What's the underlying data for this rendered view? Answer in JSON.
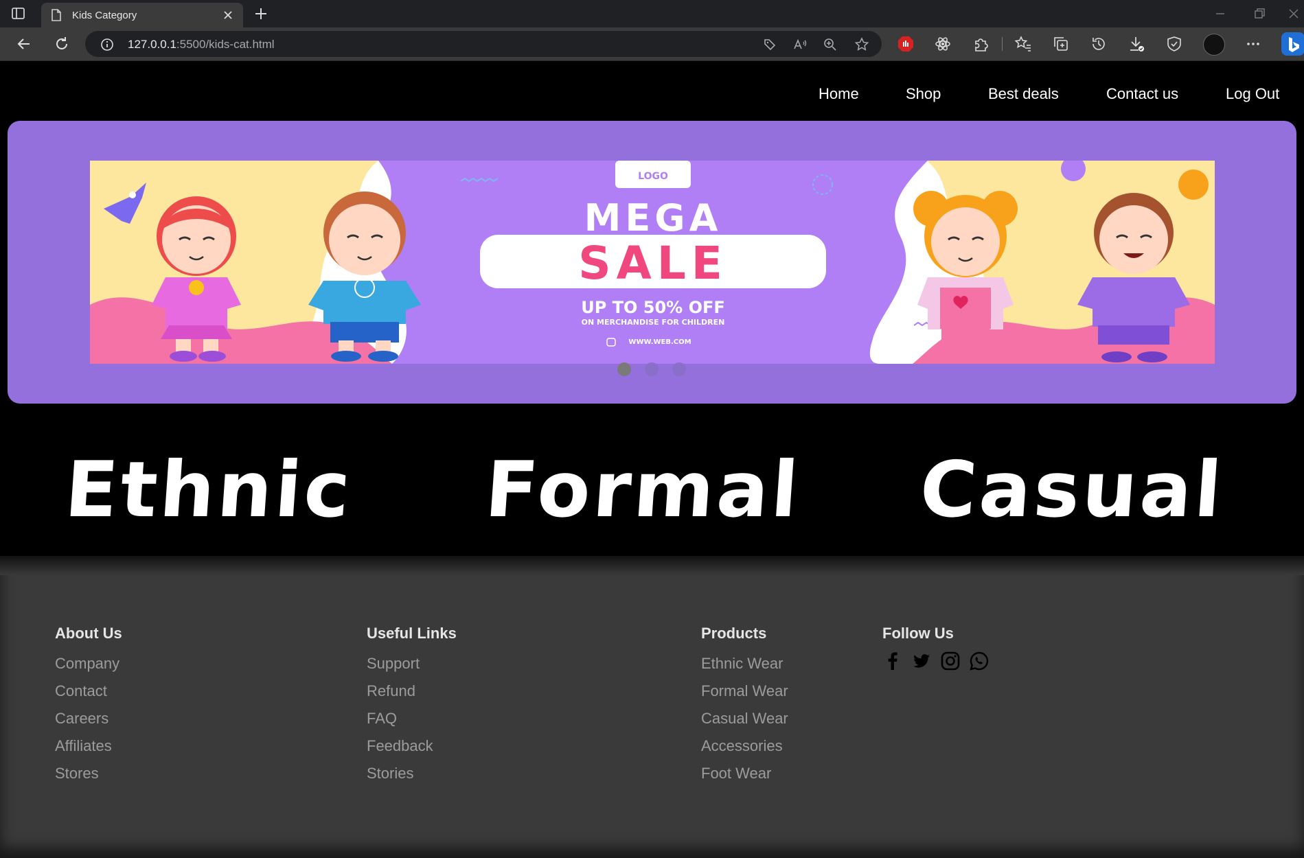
{
  "browser": {
    "tab_title": "Kids Category",
    "url_host": "127.0.0.1",
    "url_rest": ":5500/kids-cat.html"
  },
  "nav": {
    "links": [
      "Home",
      "Shop",
      "Best deals",
      "Contact us",
      "Log Out"
    ]
  },
  "banner": {
    "logo_text": "LOGO",
    "headline_1": "MEGA",
    "headline_2": "SALE",
    "offer": "UP TO 50% OFF",
    "offer_sub": "ON MERCHANDISE FOR CHILDREN",
    "website": "WWW.WEB.COM",
    "slide_count": 3,
    "active_slide": 1
  },
  "categories": [
    "Ethnic",
    "Formal",
    "Casual"
  ],
  "footer": {
    "about": {
      "title": "About Us",
      "links": [
        "Company",
        "Contact",
        "Careers",
        "Affiliates",
        "Stores"
      ]
    },
    "useful": {
      "title": "Useful Links",
      "links": [
        "Support",
        "Refund",
        "FAQ",
        "Feedback",
        "Stories"
      ]
    },
    "products": {
      "title": "Products",
      "links": [
        "Ethnic Wear",
        "Formal Wear",
        "Casual Wear",
        "Accessories",
        "Foot Wear"
      ]
    },
    "follow": {
      "title": "Follow Us",
      "icons": [
        "facebook-icon",
        "twitter-icon",
        "instagram-icon",
        "whatsapp-icon"
      ]
    }
  },
  "colors": {
    "hero_bg": "#9370db",
    "banner_purple": "#b07ef5",
    "sale_pink": "#f1477f",
    "footer_bg": "#3a3a3a"
  }
}
